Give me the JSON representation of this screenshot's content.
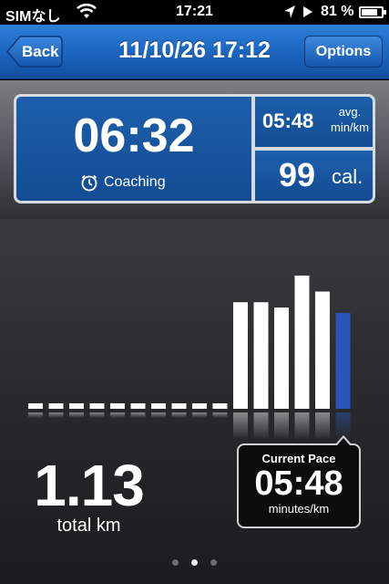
{
  "status_bar": {
    "carrier": "SIMなし",
    "time": "17:21",
    "battery_percent": "81 %",
    "battery_level": 0.81,
    "icons": [
      "wifi-icon",
      "location-arrow-icon",
      "play-icon",
      "battery-icon"
    ]
  },
  "nav": {
    "title": "11/10/26 17:12",
    "back_label": "Back",
    "options_label": "Options"
  },
  "stats": {
    "elapsed_time": "06:32",
    "coaching_label": "Coaching",
    "avg_pace": "05:48",
    "avg_pace_unit_line1": "avg.",
    "avg_pace_unit_line2": "min/km",
    "calories": "99",
    "calories_unit": "cal."
  },
  "chart_data": {
    "type": "bar",
    "y_direction": "relative pace per segment",
    "values": [
      0,
      0,
      0,
      0,
      0,
      0,
      0,
      0,
      0,
      0,
      0.8,
      0.8,
      0.76,
      1.0,
      0.88,
      0.72
    ],
    "ymax": 1.0,
    "highlighted_index": 15,
    "colors": {
      "bar": "#ffffff",
      "current": "#2b55b8"
    }
  },
  "distance": {
    "value": "1.13",
    "label": "total km"
  },
  "current_pace": {
    "title": "Current Pace",
    "value": "05:48",
    "unit": "minutes/km"
  },
  "pager": {
    "count": 3,
    "active": 1
  }
}
